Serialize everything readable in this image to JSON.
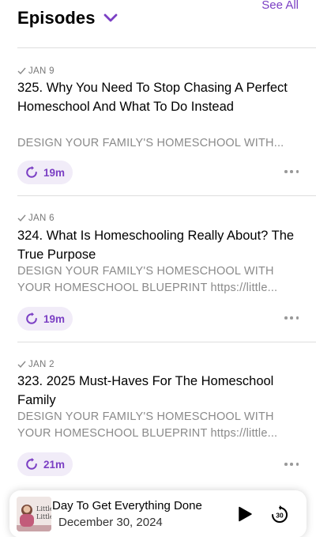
{
  "header": {
    "title": "Episodes",
    "see_all": "See All"
  },
  "episodes": [
    {
      "date": "JAN 9",
      "title": "325. Why You Need To Stop Chasing A Perfect Homeschool And What To Do Instead",
      "desc_lines": [
        "DESIGN YOUR FAMILY'S HOMESCHOOL WITH..."
      ],
      "duration": "19m"
    },
    {
      "date": "JAN 6",
      "title": "324. What Is Homeschooling Really About? The True Purpose",
      "desc_lines": [
        "DESIGN YOUR FAMILY'S HOMESCHOOL WITH",
        "YOUR HOMESCHOOL BLUEPRINT  https://little..."
      ],
      "duration": "19m"
    },
    {
      "date": "JAN 2",
      "title": "323. 2025 Must-Haves For The Homeschool Family",
      "desc_lines": [
        "DESIGN YOUR FAMILY'S HOMESCHOOL WITH",
        "YOUR HOMESCHOOL BLUEPRINT  https://little..."
      ],
      "duration": "21m"
    }
  ],
  "mini_player": {
    "title": "Day To Get Everything Done",
    "date": "December 30, 2024",
    "artwork_text": "Little Little",
    "skip_seconds": "30"
  },
  "colors": {
    "accent": "#7b3fc4",
    "pill_bg": "#f1ecf8",
    "muted": "#8a8a8a"
  }
}
